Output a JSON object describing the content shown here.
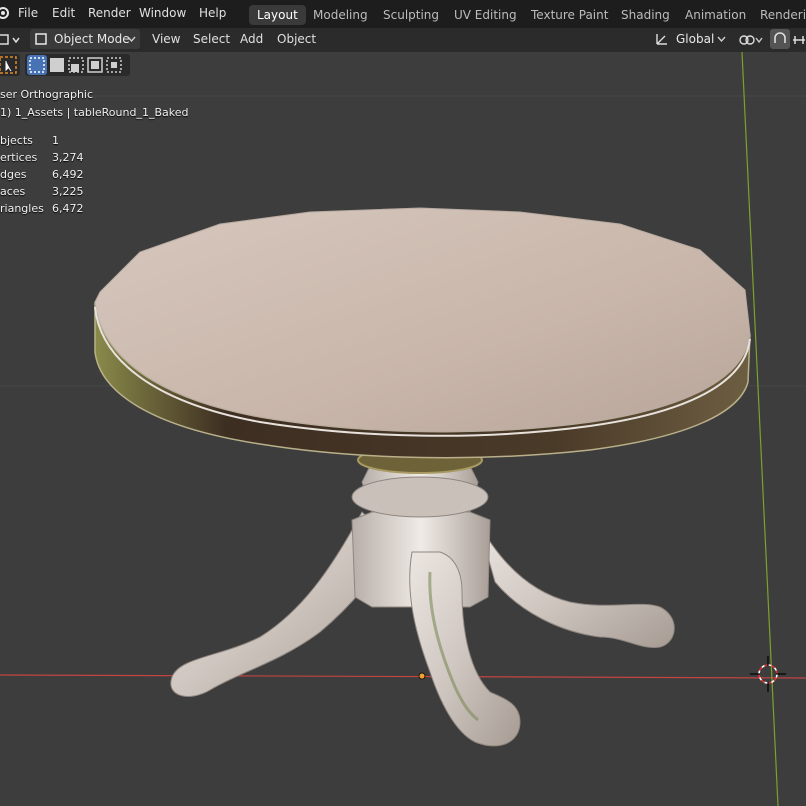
{
  "menu": [
    "File",
    "Edit",
    "Render",
    "Window",
    "Help"
  ],
  "workspace_tabs": [
    "Layout",
    "Modeling",
    "Sculpting",
    "UV Editing",
    "Texture Paint",
    "Shading",
    "Animation",
    "Renderin"
  ],
  "active_tab": "Layout",
  "header": {
    "mode": "Object Mode",
    "view_menu": [
      "View",
      "Select",
      "Add",
      "Object"
    ],
    "orientation": "Global"
  },
  "overlay": {
    "view_name": "ser Orthographic",
    "collection": "1) 1_Assets | tableRound_1_Baked",
    "stats": [
      {
        "label": "bjects",
        "value": "1"
      },
      {
        "label": "ertices",
        "value": "3,274"
      },
      {
        "label": "dges",
        "value": "6,492"
      },
      {
        "label": "aces",
        "value": "3,225"
      },
      {
        "label": "riangles",
        "value": "6,472"
      }
    ]
  },
  "colors": {
    "background": "#3d3d3d",
    "topbar": "#1d1d1d",
    "header": "#2b2b2b",
    "x_axis": "#c44444",
    "y_axis": "#7aa22d",
    "select_accent": "#4772b3"
  },
  "icons": [
    "blender-logo-icon",
    "editor-type-icon",
    "object-mode-icon",
    "chevron-down-icon",
    "transform-orientation-icon",
    "pivot-icon",
    "snap-icon",
    "select-tool-icon",
    "select-mode-icons",
    "3d-cursor-icon",
    "origin-dot-icon"
  ]
}
